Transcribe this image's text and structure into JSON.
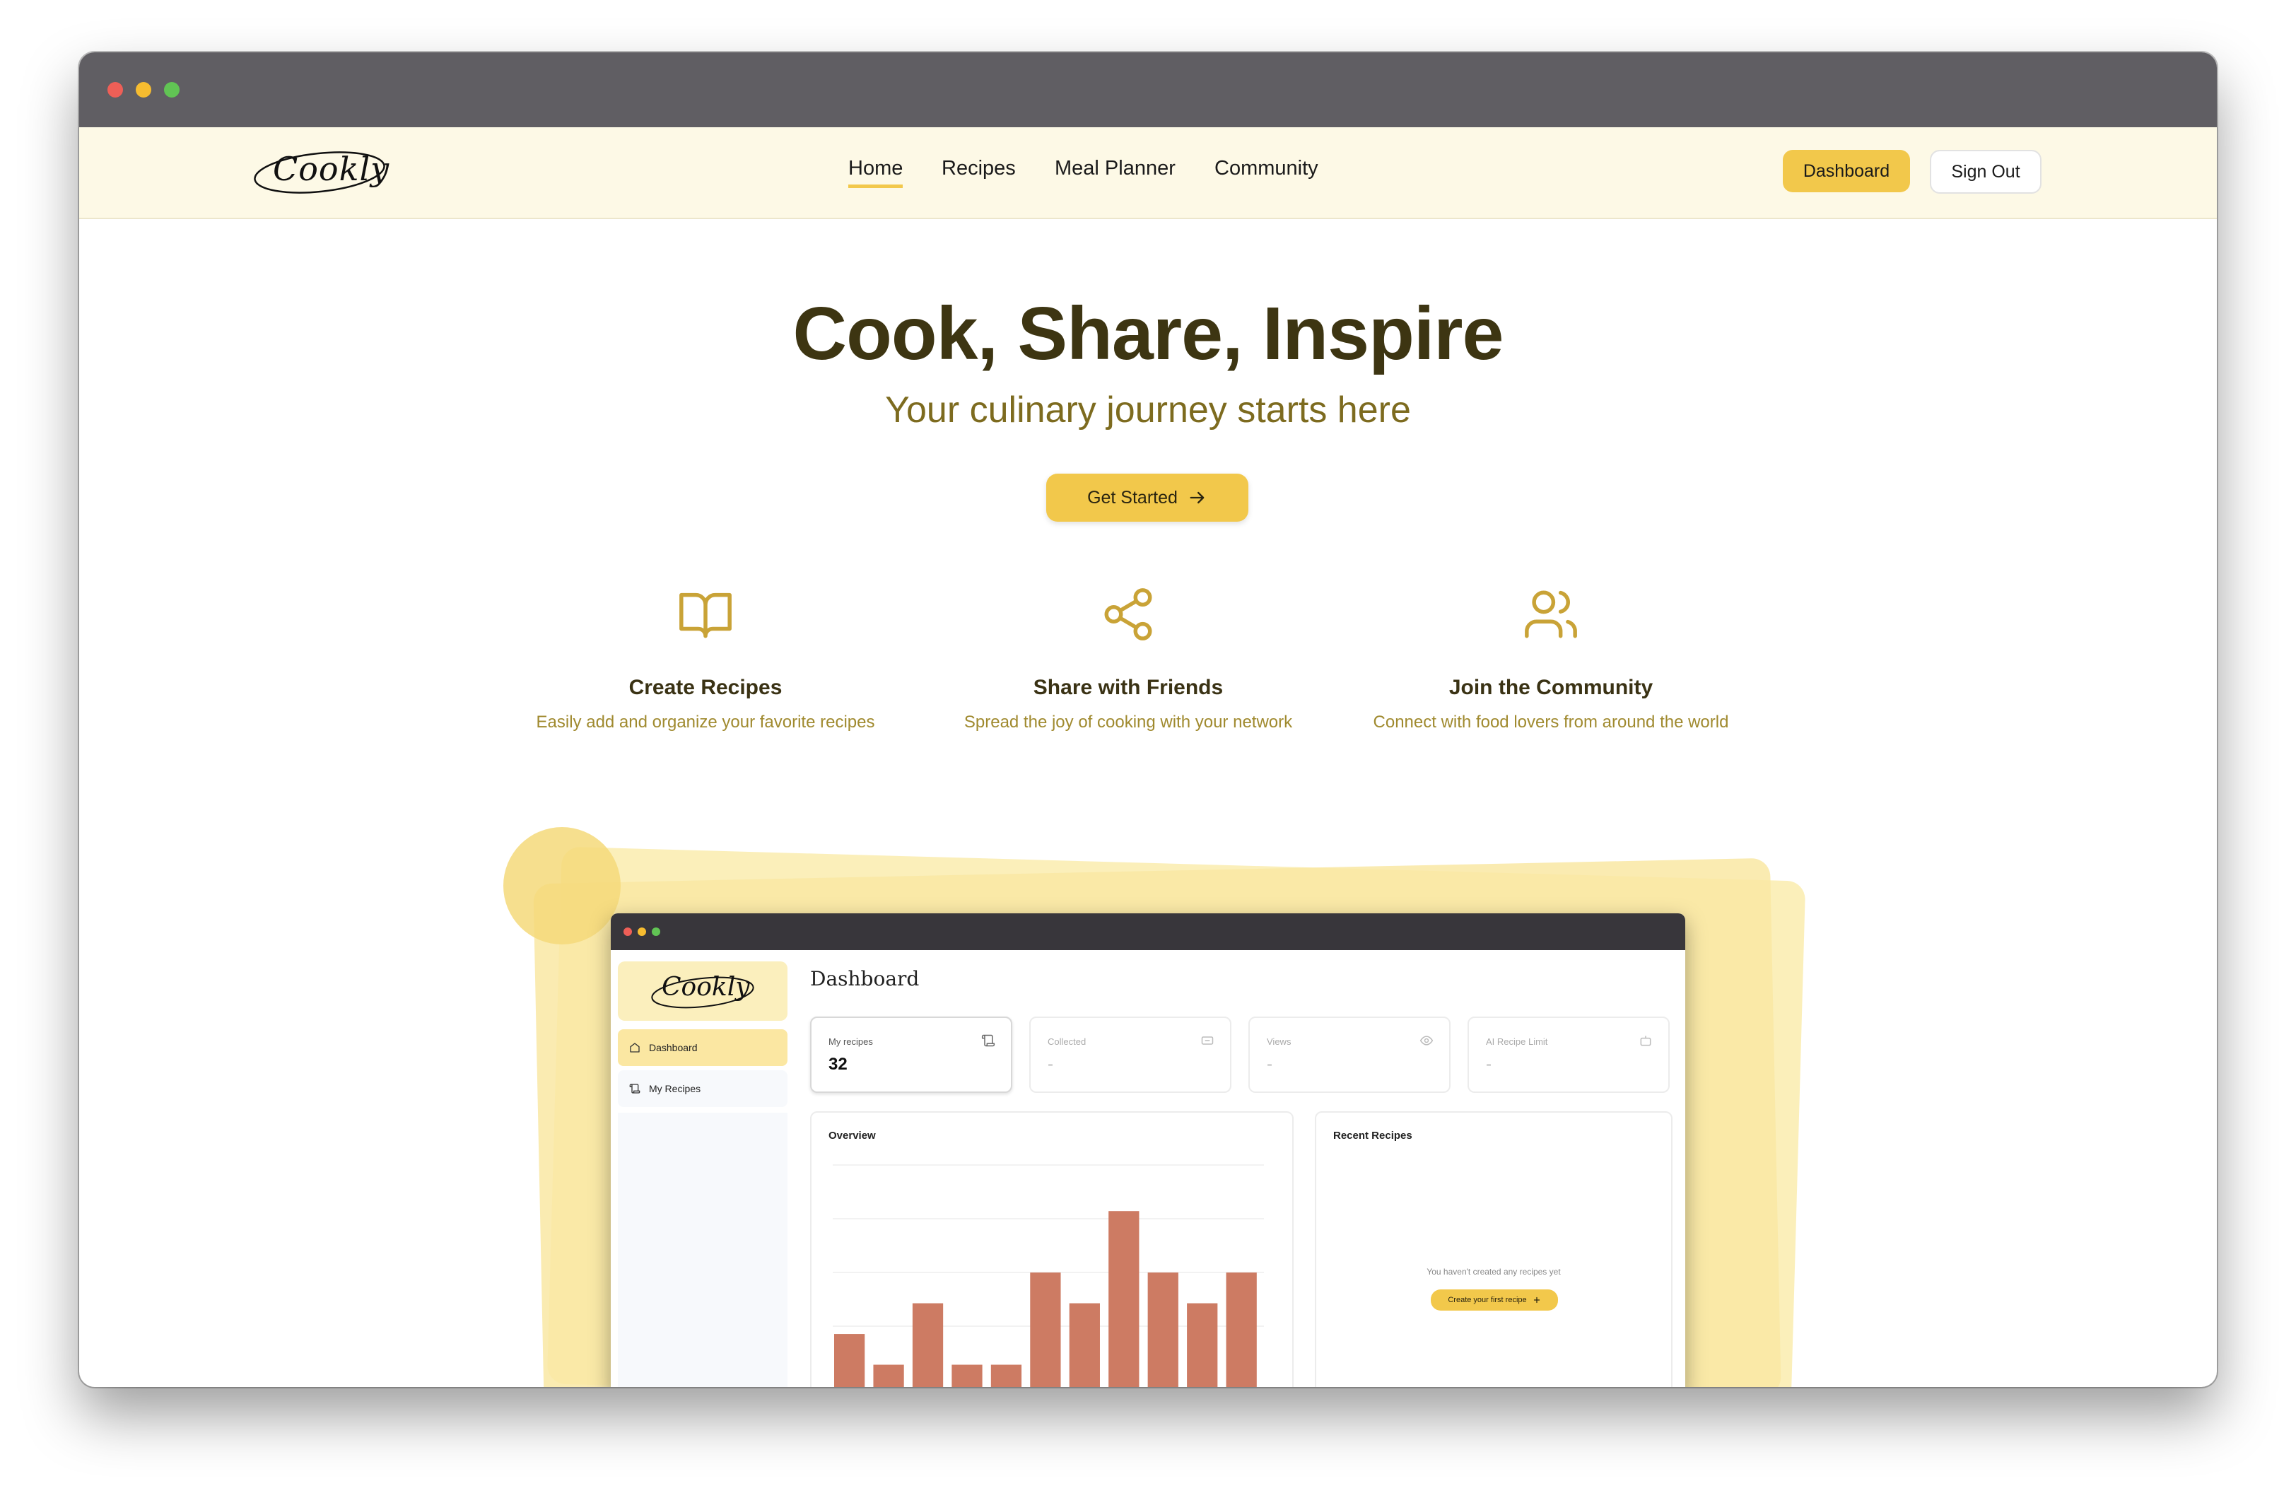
{
  "app": {
    "logo": "Cookly",
    "nav": [
      "Home",
      "Recipes",
      "Meal Planner",
      "Community"
    ],
    "active_nav": "Home",
    "dashboard_button": "Dashboard",
    "signout_button": "Sign Out"
  },
  "hero": {
    "title": "Cook, Share, Inspire",
    "subtitle": "Your culinary journey starts here",
    "cta": "Get Started"
  },
  "features": [
    {
      "title": "Create Recipes",
      "desc": "Easily add and organize your favorite recipes",
      "icon": "book-open-icon"
    },
    {
      "title": "Share with Friends",
      "desc": "Spread the joy of cooking with your network",
      "icon": "share-icon"
    },
    {
      "title": "Join the Community",
      "desc": "Connect with food lovers from around the world",
      "icon": "users-icon"
    }
  ],
  "preview": {
    "logo": "Cookly",
    "sidebar": [
      "Dashboard",
      "My Recipes"
    ],
    "heading": "Dashboard",
    "stats": [
      {
        "label": "My recipes",
        "value": "32",
        "icon": "scroll-icon"
      },
      {
        "label": "Collected",
        "value": "-",
        "icon": "card-icon"
      },
      {
        "label": "Views",
        "value": "-",
        "icon": "eye-icon"
      },
      {
        "label": "AI Recipe Limit",
        "value": "-",
        "icon": "bot-icon"
      }
    ],
    "overview_title": "Overview",
    "recent_title": "Recent Recipes",
    "empty_text": "You haven't created any recipes yet",
    "create_button": "Create your first recipe"
  },
  "chart_data": {
    "type": "bar",
    "values": [
      40,
      20,
      60,
      20,
      20,
      80,
      60,
      120,
      80,
      60,
      80
    ],
    "bar_color": "#cd7b63"
  },
  "colors": {
    "accent": "#f2c84b",
    "title": "#3d3512",
    "subtitle": "#7d6b1f",
    "nav_bg": "#fdf9e6"
  }
}
